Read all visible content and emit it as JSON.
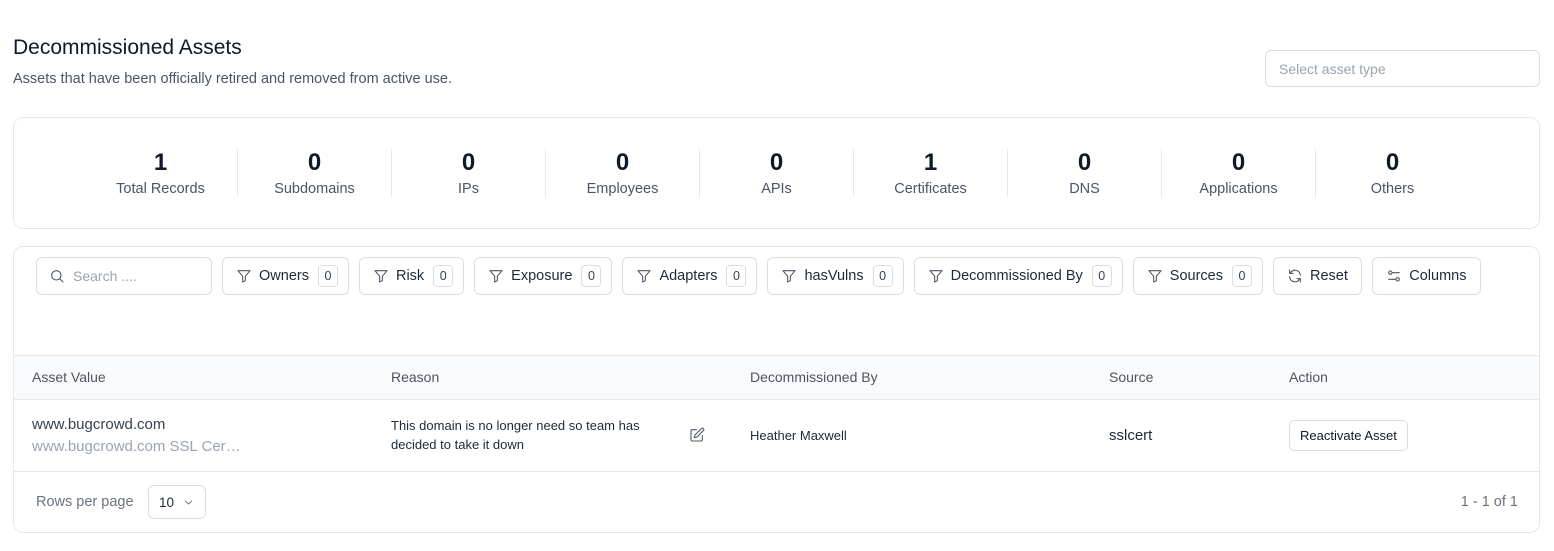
{
  "header": {
    "title": "Decommissioned Assets",
    "subtitle": "Assets that have been officially retired and removed from active use.",
    "asset_type_placeholder": "Select asset type"
  },
  "stats": [
    {
      "value": "1",
      "label": "Total Records"
    },
    {
      "value": "0",
      "label": "Subdomains"
    },
    {
      "value": "0",
      "label": "IPs"
    },
    {
      "value": "0",
      "label": "Employees"
    },
    {
      "value": "0",
      "label": "APIs"
    },
    {
      "value": "1",
      "label": "Certificates"
    },
    {
      "value": "0",
      "label": "DNS"
    },
    {
      "value": "0",
      "label": "Applications"
    },
    {
      "value": "0",
      "label": "Others"
    }
  ],
  "toolbar": {
    "search_placeholder": "Search ....",
    "filters": [
      {
        "label": "Owners",
        "count": "0"
      },
      {
        "label": "Risk",
        "count": "0"
      },
      {
        "label": "Exposure",
        "count": "0"
      },
      {
        "label": "Adapters",
        "count": "0"
      },
      {
        "label": "hasVulns",
        "count": "0"
      },
      {
        "label": "Decommissioned By",
        "count": "0"
      },
      {
        "label": "Sources",
        "count": "0"
      }
    ],
    "reset_label": "Reset",
    "columns_label": "Columns",
    "filter_icon": "filter-icon",
    "search_icon": "search-icon",
    "reset_icon": "refresh-icon",
    "columns_icon": "sliders-icon"
  },
  "table": {
    "columns": [
      "Asset Value",
      "Reason",
      "Decommissioned By",
      "Source",
      "Action"
    ],
    "rows": [
      {
        "asset_value": "www.bugcrowd.com",
        "asset_detail": "www.bugcrowd.com SSL Certificate",
        "reason": "This domain is no longer need so team has decided to take it down",
        "decommissioned_by": "Heather Maxwell",
        "source": "sslcert",
        "action_label": "Reactivate Asset"
      }
    ]
  },
  "footer": {
    "rows_per_page_label": "Rows per page",
    "rows_per_page_value": "10",
    "pagination_text": "1 - 1 of 1"
  },
  "colors": {
    "border": "#e5e7eb",
    "header_bg": "#f9fafb",
    "text_muted": "#6b7280"
  }
}
